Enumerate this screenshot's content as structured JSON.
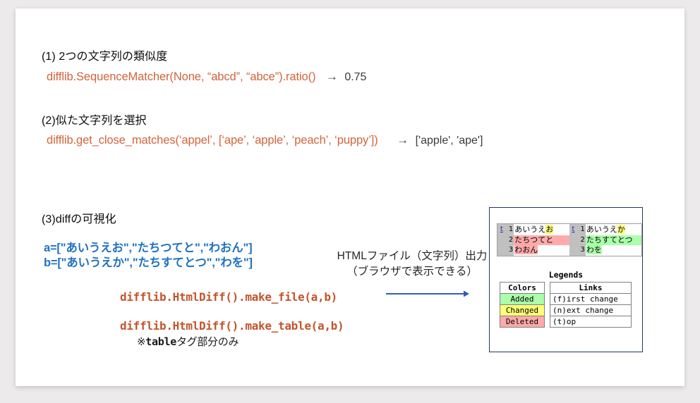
{
  "slide": {
    "sections": [
      {
        "id": "similarity",
        "heading": "(1) 2つの文字列の類似度",
        "code": "difflib.SequenceMatcher(None, “abcd”, “abce”).ratio()",
        "arrow": "→",
        "result": "0.75"
      },
      {
        "id": "close-matches",
        "heading": "(2)似た文字列を選択",
        "code": "difflib.get_close_matches(‘appel’, [‘ape’, ‘apple’, ‘peach’, ‘puppy’])",
        "arrow": "→",
        "result": "['apple', 'ape']"
      },
      {
        "id": "diff-visualize",
        "heading": "(3)diffの可視化"
      }
    ],
    "inputs": {
      "line_a": "a=[\"あいうえお\",\"たちつてと\",\"わおん\"]",
      "line_b": "b=[\"あいうえか\",\"たちすてとつ\",\"わを\"]"
    },
    "output_note": {
      "line1": "HTMLファイル（文字列）出力",
      "line2": "（ブラウザで表示できる）"
    },
    "methods": {
      "make_file": "difflib.HtmlDiff().make_file(a,b)",
      "make_table": "difflib.HtmlDiff().make_table(a,b)",
      "make_table_note": "※tableタグ部分のみ",
      "note_mono_part": "table",
      "note_prefix": "※",
      "note_suffix": "タグ部分のみ"
    },
    "arrow_icon_label": "right-arrow"
  },
  "diff_panel": {
    "left_rows": [
      {
        "link": "t",
        "num": "1",
        "plain_before": "あいうえ",
        "marked": "お",
        "mark_type": "changed",
        "plain_after": "",
        "row_fill": "none"
      },
      {
        "link": "",
        "num": "2",
        "plain_before": "たちつてと",
        "marked": "",
        "mark_type": "none",
        "plain_after": "",
        "row_fill": "deleted"
      },
      {
        "link": "",
        "num": "3",
        "plain_before": "わおん",
        "marked": "",
        "mark_type": "none",
        "plain_after": "",
        "row_fill": "deleted"
      }
    ],
    "right_rows": [
      {
        "link": "t",
        "num": "1",
        "plain_before": "あいうえ",
        "marked": "か",
        "mark_type": "changed",
        "plain_after": "",
        "row_fill": "none"
      },
      {
        "link": "",
        "num": "2",
        "plain_before": "たちすてとつ",
        "marked": "",
        "mark_type": "none",
        "plain_after": "",
        "row_fill": "added"
      },
      {
        "link": "",
        "num": "3",
        "plain_before": "わを",
        "marked": "",
        "mark_type": "none",
        "plain_after": "",
        "row_fill": "added"
      }
    ],
    "legends_title": "Legends",
    "legend_colors": {
      "header": "Colors",
      "rows": [
        {
          "label": "Added",
          "fill": "added"
        },
        {
          "label": "Changed",
          "fill": "changed"
        },
        {
          "label": "Deleted",
          "fill": "deleted"
        }
      ]
    },
    "legend_links": {
      "header": "Links",
      "rows": [
        {
          "label": "(f)irst change"
        },
        {
          "label": "(n)ext change"
        },
        {
          "label": "(t)op"
        }
      ]
    }
  },
  "colors": {
    "code_orange": "#d2643a",
    "code_blue": "#2072c0",
    "panel_border": "#1f3864",
    "arrow_blue": "#2f5eb8",
    "added": "#aaffaa",
    "changed": "#ffff77",
    "deleted": "#ffaaaa",
    "gutter": "#c0c0c0",
    "page_bg": "#eceaea",
    "card_bg": "#ffffff"
  }
}
